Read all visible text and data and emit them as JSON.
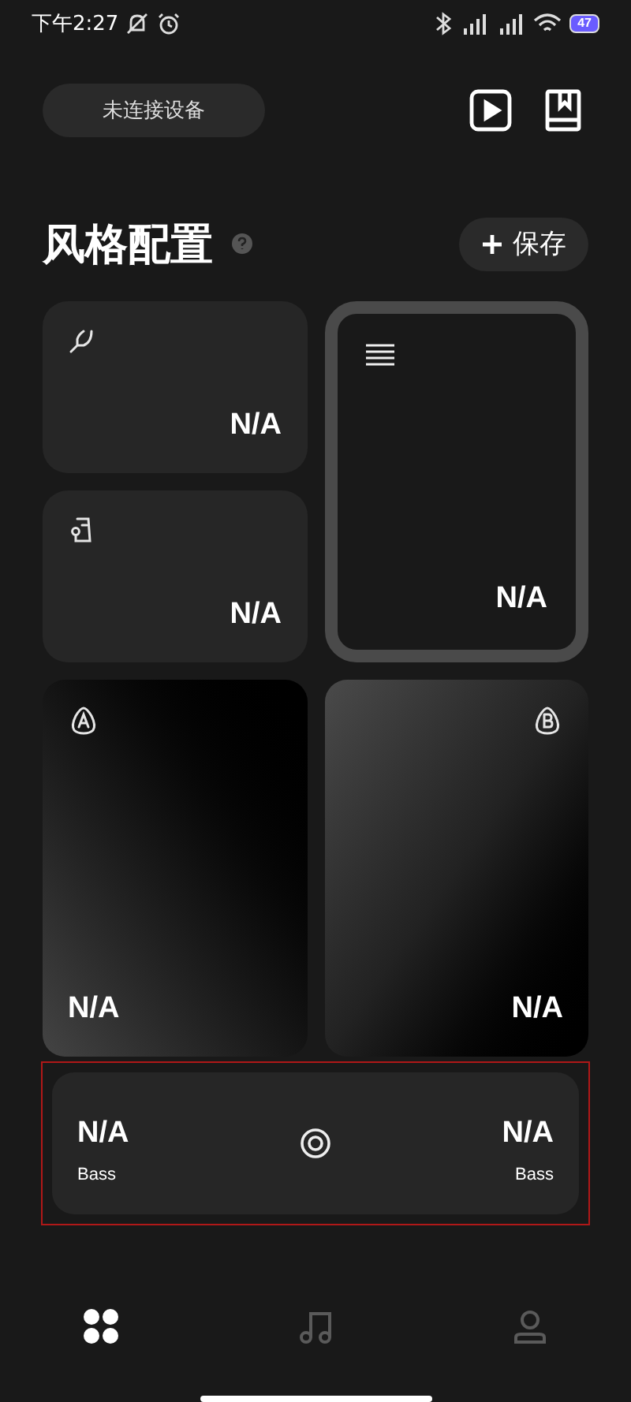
{
  "status_bar": {
    "time": "下午2:27",
    "battery": "47"
  },
  "device_button": "未连接设备",
  "section": {
    "title": "风格配置",
    "save_button": "保存"
  },
  "small_cards": [
    {
      "kind": "fork",
      "value": "N/A"
    },
    {
      "kind": "stamp",
      "value": "N/A"
    }
  ],
  "list_card": {
    "value": "N/A",
    "selected": true
  },
  "ab_cards": [
    {
      "kind": "a",
      "value": "N/A"
    },
    {
      "kind": "b",
      "value": "N/A"
    }
  ],
  "bass_card": {
    "highlighted": true,
    "left_value": "N/A",
    "left_label": "Bass",
    "right_value": "N/A",
    "right_label": "Bass"
  },
  "nav": [
    {
      "kind": "grid",
      "selected": true
    },
    {
      "kind": "music",
      "selected": false
    },
    {
      "kind": "person",
      "selected": false
    }
  ]
}
